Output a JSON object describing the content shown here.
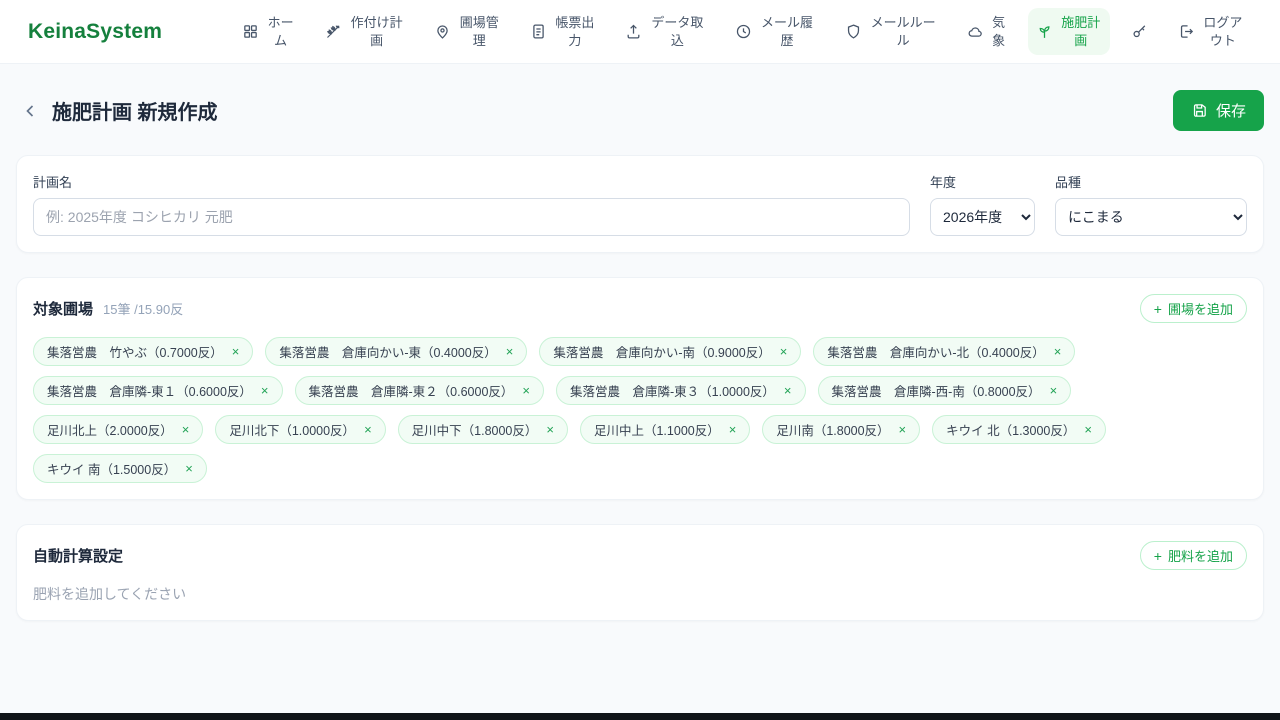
{
  "brand": "KeinaSystem",
  "icons": {
    "plus": "+",
    "close": "×"
  },
  "nav": {
    "items": [
      {
        "label": "ホーム",
        "icon": "grid-icon"
      },
      {
        "label": "作付け計画",
        "icon": "wheat-icon"
      },
      {
        "label": "圃場管理",
        "icon": "map-pin-icon"
      },
      {
        "label": "帳票出力",
        "icon": "document-icon"
      },
      {
        "label": "データ取込",
        "icon": "upload-icon"
      },
      {
        "label": "メール履歴",
        "icon": "history-icon"
      },
      {
        "label": "メールルール",
        "icon": "shield-icon"
      },
      {
        "label": "気象",
        "icon": "cloud-icon"
      },
      {
        "label": "施肥計画",
        "icon": "sprout-icon",
        "active": true
      },
      {
        "label": "",
        "icon": "key-icon"
      },
      {
        "label": "ログアウト",
        "icon": "logout-icon"
      }
    ]
  },
  "header": {
    "title": "施肥計画 新規作成",
    "save_label": "保存"
  },
  "form": {
    "plan_name_label": "計画名",
    "plan_name_placeholder": "例: 2025年度 コシヒカリ 元肥",
    "plan_name_value": "",
    "year_label": "年度",
    "year_value": "2026年度",
    "variety_label": "品種",
    "variety_value": "にこまる"
  },
  "fields_section": {
    "title": "対象圃場",
    "summary": "15筆 /15.90反",
    "add_button_label": "圃場を追加",
    "chips": [
      {
        "label": "集落営農　竹やぶ（0.7000反）"
      },
      {
        "label": "集落営農　倉庫向かい-東（0.4000反）"
      },
      {
        "label": "集落営農　倉庫向かい-南（0.9000反）"
      },
      {
        "label": "集落営農　倉庫向かい-北（0.4000反）"
      },
      {
        "label": "集落営農　倉庫隣-東１（0.6000反）"
      },
      {
        "label": "集落営農　倉庫隣-東２（0.6000反）"
      },
      {
        "label": "集落営農　倉庫隣-東３（1.0000反）"
      },
      {
        "label": "集落営農　倉庫隣-西-南（0.8000反）"
      },
      {
        "label": "足川北上（2.0000反）"
      },
      {
        "label": "足川北下（1.0000反）"
      },
      {
        "label": "足川中下（1.8000反）"
      },
      {
        "label": "足川中上（1.1000反）"
      },
      {
        "label": "足川南（1.8000反）"
      },
      {
        "label": "キウイ 北（1.3000反）"
      },
      {
        "label": "キウイ 南（1.5000反）"
      }
    ]
  },
  "fertilizer_section": {
    "title": "自動計算設定",
    "add_button_label": "肥料を追加",
    "empty_message": "肥料を追加してください"
  },
  "colors": {
    "accent": "#16a34a",
    "brand": "#15803d",
    "chip_bg": "#f2fcf5",
    "chip_border": "#c9f2d6"
  }
}
